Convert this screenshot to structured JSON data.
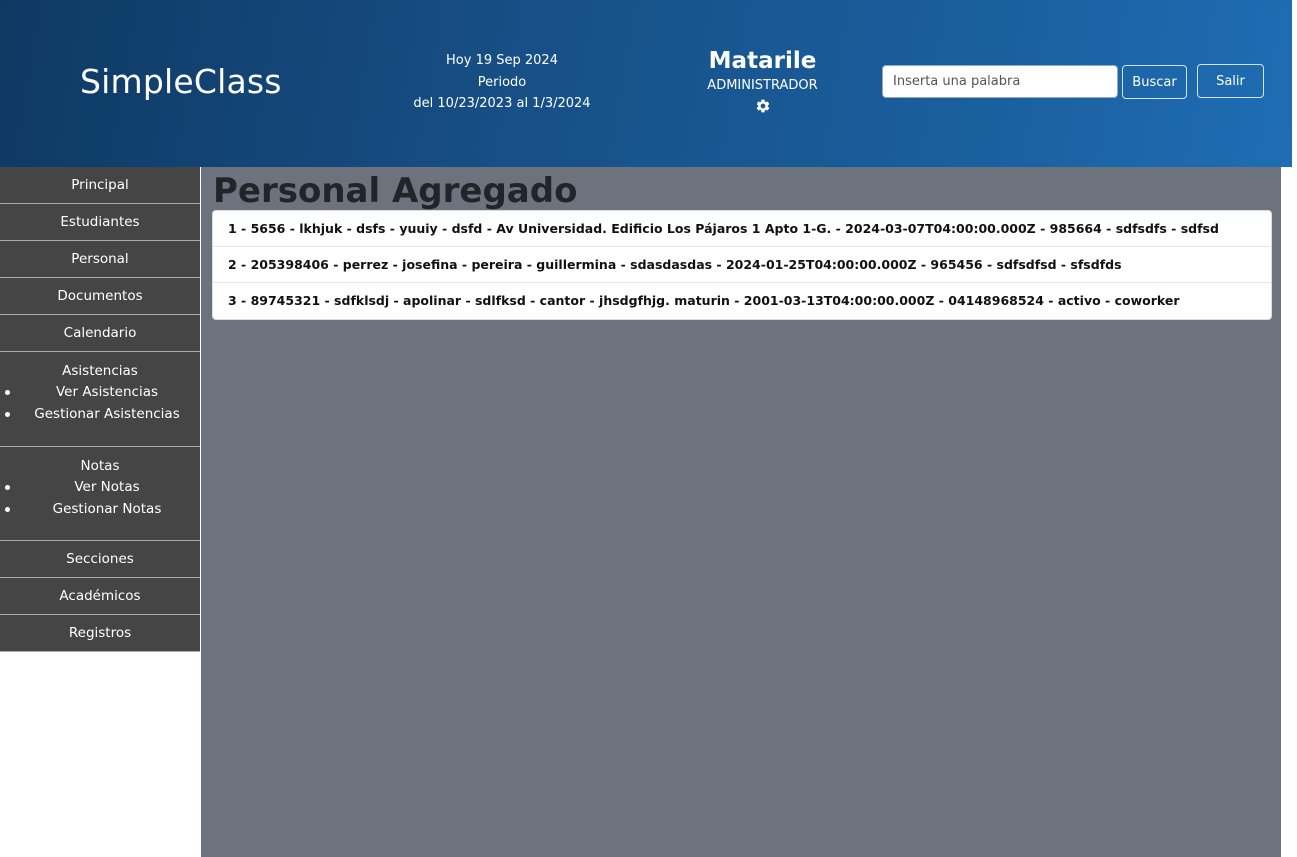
{
  "header": {
    "brand": "SimpleClass",
    "date_line": "Hoy 19 Sep 2024",
    "period_label": "Periodo",
    "period_range": "del 10/23/2023 al 1/3/2024",
    "user_name": "Matarile",
    "user_role": "ADMINISTRADOR",
    "settings_icon": "gear-icon",
    "search_placeholder": "Inserta una palabra",
    "search_button": "Buscar",
    "logout_button": "Salir"
  },
  "sidebar": {
    "items": [
      {
        "label": "Principal"
      },
      {
        "label": "Estudiantes"
      },
      {
        "label": "Personal"
      },
      {
        "label": "Documentos"
      },
      {
        "label": "Calendario"
      }
    ],
    "asistencias": {
      "label": "Asistencias",
      "children": [
        "Ver Asistencias",
        "Gestionar Asistencias"
      ]
    },
    "notas": {
      "label": "Notas",
      "children": [
        "Ver Notas",
        "Gestionar Notas"
      ]
    },
    "bottom_items": [
      {
        "label": "Secciones"
      },
      {
        "label": "Académicos"
      },
      {
        "label": "Registros"
      }
    ]
  },
  "main": {
    "title": "Personal Agregado",
    "records": [
      "1 - 5656 - lkhjuk - dsfs - yuuiy - dsfd - Av Universidad. Edificio Los Pájaros 1 Apto 1-G. - 2024-03-07T04:00:00.000Z - 985664 - sdfsdfs - sdfsd",
      "2 - 205398406 - perrez - josefina - pereira - guillermina - sdasdasdas - 2024-01-25T04:00:00.000Z - 965456 - sdfsdfsd - sfsdfds",
      "3 - 89745321 - sdfklsdj - apolinar - sdlfksd - cantor - jhsdgfhjg. maturin - 2001-03-13T04:00:00.000Z - 04148968524 - activo - coworker"
    ]
  },
  "colors": {
    "header_gradient_start": "#0e3963",
    "header_gradient_end": "#1f6db4",
    "sidebar_bg": "#454545",
    "main_bg": "#6c737d"
  }
}
